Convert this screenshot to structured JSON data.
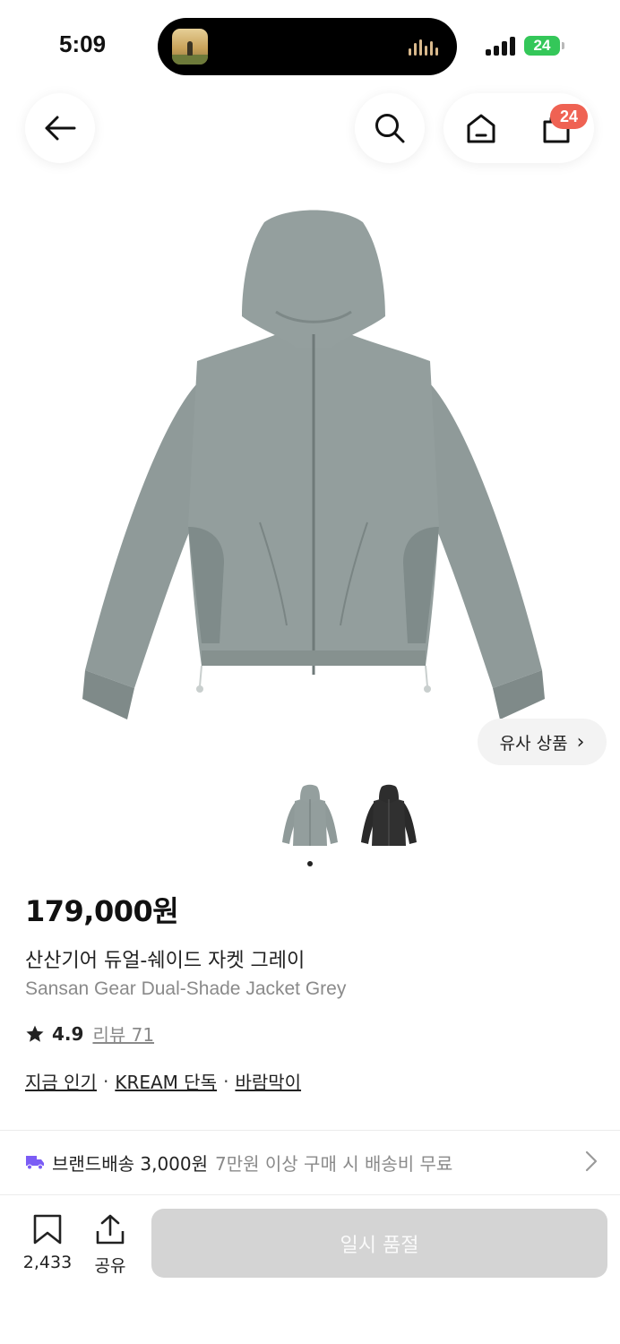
{
  "status_bar": {
    "time": "5:09",
    "battery": "24"
  },
  "nav": {
    "back_icon": "arrow-left-icon",
    "search_icon": "search-icon",
    "home_icon": "home-icon",
    "cart_icon": "shopping-bag-icon",
    "cart_badge": "24",
    "badge_color": "#ef6253"
  },
  "product": {
    "image_alt_colors": {
      "grey": "#8f9a99",
      "black": "#2a2a2a"
    },
    "similar_button": "유사 상품",
    "thumbnails": [
      "grey",
      "black"
    ],
    "price": "179,000원",
    "name_ko": "산산기어 듀얼-쉐이드 자켓 그레이",
    "name_en": "Sansan Gear Dual-Shade Jacket Grey",
    "rating": "4.9",
    "review_label": "리뷰 71",
    "tags": [
      "지금 인기",
      "KREAM 단독",
      "바람막이"
    ]
  },
  "shipping": {
    "icon": "truck-icon",
    "icon_color": "#7b5cf5",
    "title": "브랜드배송 3,000원",
    "note": "7만원 이상 구매 시 배송비 무료"
  },
  "bottom_bar": {
    "bookmark_count": "2,433",
    "share_label": "공유",
    "soldout_label": "일시 품절"
  }
}
